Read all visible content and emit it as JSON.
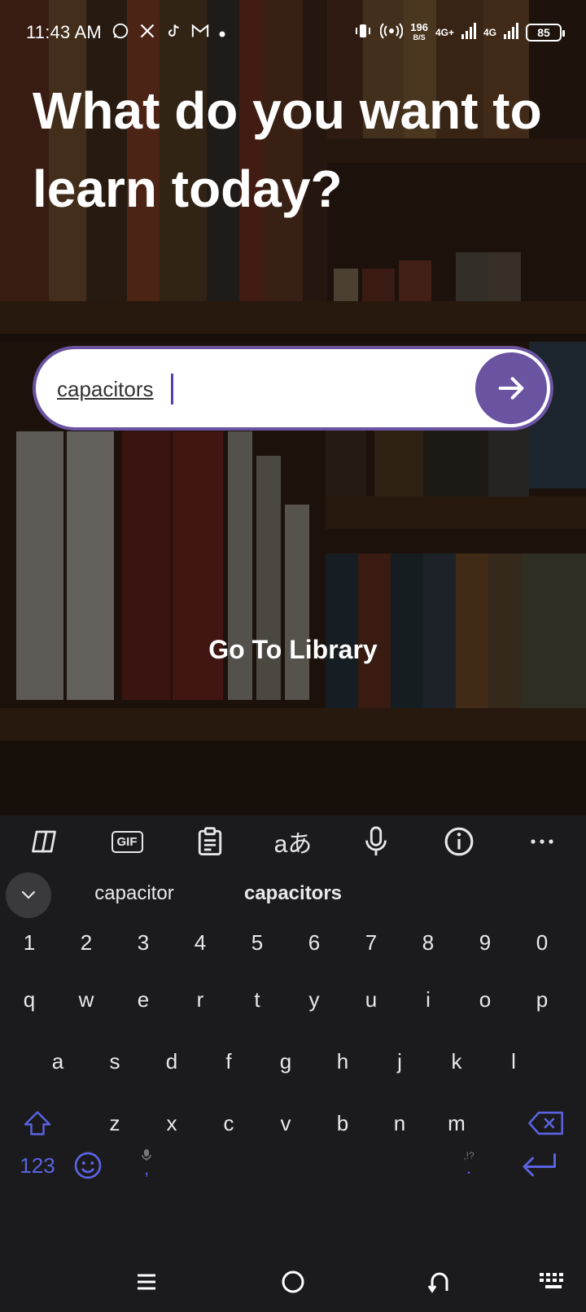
{
  "status_bar": {
    "time": "11:43 AM",
    "notification_icons": [
      "whatsapp-icon",
      "x-icon",
      "tiktok-icon",
      "gmail-icon",
      "dot-icon"
    ],
    "net_speed_value": "196",
    "net_speed_unit": "B/S",
    "network_1": "4G+",
    "network_2": "4G",
    "battery": "85"
  },
  "headline": "What do you want to learn today?",
  "search": {
    "value": "capacitors",
    "submit_icon": "arrow-right-icon",
    "accent_color": "#6a54a2"
  },
  "library_link": "Go To Library",
  "keyboard": {
    "toolbar": [
      "copilot-icon",
      "gif-icon",
      "clipboard-icon",
      "translate-icon",
      "microphone-icon",
      "info-icon",
      "more-icon"
    ],
    "gif_label": "GIF",
    "suggestions": [
      "capacitor",
      "capacitors"
    ],
    "number_row": [
      "1",
      "2",
      "3",
      "4",
      "5",
      "6",
      "7",
      "8",
      "9",
      "0"
    ],
    "row1": [
      "q",
      "w",
      "e",
      "r",
      "t",
      "y",
      "u",
      "i",
      "o",
      "p"
    ],
    "row2": [
      "a",
      "s",
      "d",
      "f",
      "g",
      "h",
      "j",
      "k",
      "l"
    ],
    "row3": [
      "z",
      "x",
      "c",
      "v",
      "b",
      "n",
      "m"
    ],
    "symbols_key": "123",
    "comma_key": ",",
    "period_key": ".",
    "period_hint": ",!?",
    "accent_color": "#5a63e0"
  },
  "nav_bar": [
    "recents-icon",
    "home-icon",
    "back-icon",
    "keyboard-switch-icon"
  ]
}
